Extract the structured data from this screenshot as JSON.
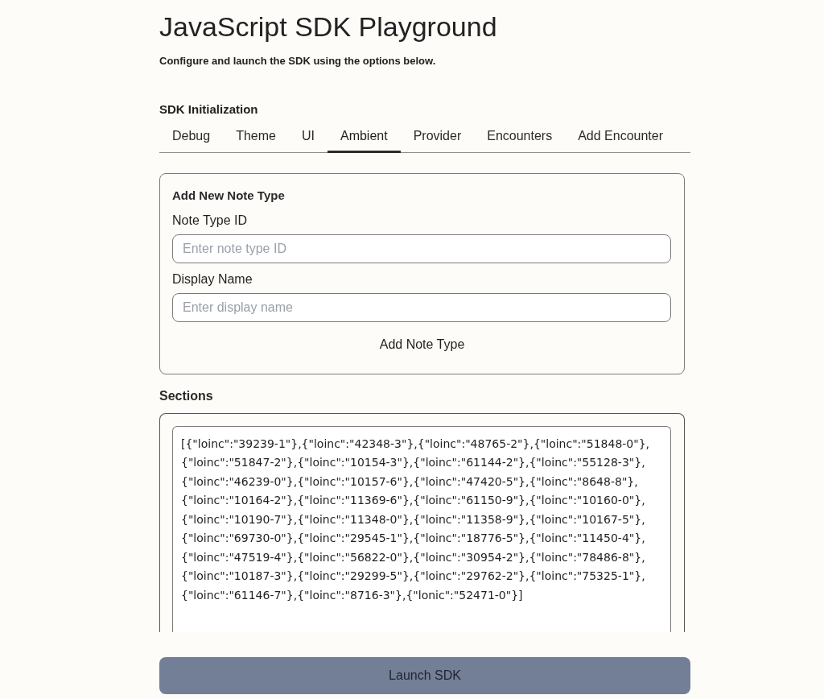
{
  "page": {
    "title": "JavaScript SDK Playground",
    "subtitle": "Configure and launch the SDK using the options below."
  },
  "sdk_initialization": {
    "heading": "SDK Initialization",
    "tabs": [
      {
        "label": "Debug",
        "selected": false
      },
      {
        "label": "Theme",
        "selected": false
      },
      {
        "label": "UI",
        "selected": false
      },
      {
        "label": "Ambient",
        "selected": true
      },
      {
        "label": "Provider",
        "selected": false
      },
      {
        "label": "Encounters",
        "selected": false
      },
      {
        "label": "Add Encounter",
        "selected": false
      }
    ]
  },
  "add_note_type": {
    "heading": "Add New Note Type",
    "fields": [
      {
        "label": "Note Type ID",
        "placeholder": "Enter note type ID"
      },
      {
        "label": "Display Name",
        "placeholder": "Enter display name"
      }
    ],
    "button": "Add Note Type"
  },
  "sections": {
    "label": "Sections",
    "value": "[{\"loinc\":\"39239-1\"},{\"loinc\":\"42348-3\"},{\"loinc\":\"48765-2\"},{\"loinc\":\"51848-0\"},{\"loinc\":\"51847-2\"},{\"loinc\":\"10154-3\"},{\"loinc\":\"61144-2\"},{\"loinc\":\"55128-3\"},{\"loinc\":\"46239-0\"},{\"loinc\":\"10157-6\"},{\"loinc\":\"47420-5\"},{\"loinc\":\"8648-8\"},{\"loinc\":\"10164-2\"},{\"loinc\":\"11369-6\"},{\"loinc\":\"61150-9\"},{\"loinc\":\"10160-0\"},{\"loinc\":\"10190-7\"},{\"loinc\":\"11348-0\"},{\"loinc\":\"11358-9\"},{\"loinc\":\"10167-5\"},{\"loinc\":\"69730-0\"},{\"loinc\":\"29545-1\"},{\"loinc\":\"18776-5\"},{\"loinc\":\"11450-4\"},{\"loinc\":\"47519-4\"},{\"loinc\":\"56822-0\"},{\"loinc\":\"30954-2\"},{\"loinc\":\"78486-8\"},{\"loinc\":\"10187-3\"},{\"loinc\":\"29299-5\"},{\"loinc\":\"29762-2\"},{\"loinc\":\"75325-1\"},{\"loinc\":\"61146-7\"},{\"loinc\":\"8716-3\"},{\"lonic\":\"52471-0\"}]"
  },
  "footer": {
    "button": "Launch SDK"
  }
}
